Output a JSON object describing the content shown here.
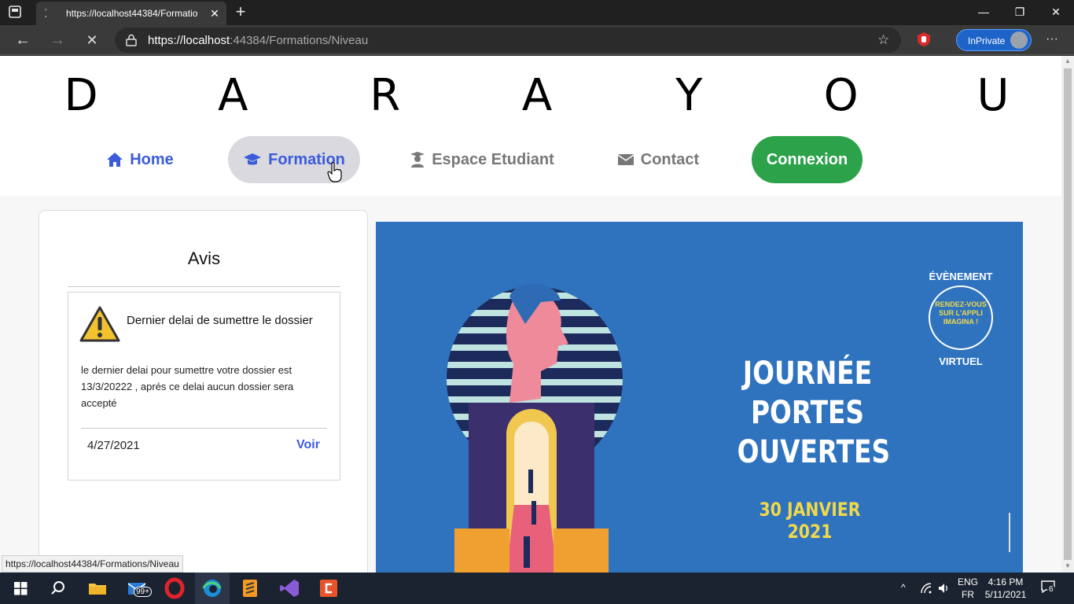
{
  "browser": {
    "tab_title": "https://localhost44384/Formatio",
    "url_main": "https://localhost",
    "url_rest": ":44384/Formations/Niveau",
    "inprivate_label": "InPrivate",
    "status_url": "https://localhost44384/Formations/Niveau"
  },
  "site": {
    "brand_letters": [
      "D",
      "A",
      "R",
      "A",
      "Y",
      "O",
      "U"
    ],
    "nav": {
      "home": "Home",
      "formation": "Formation",
      "etudiant": "Espace Etudiant",
      "contact": "Contact",
      "connexion": "Connexion"
    },
    "avis": {
      "title": "Avis",
      "notice_title": "Dernier delai de sumettre le dossier",
      "notice_body": "le dernier delai pour sumettre votre dossier est 13/3/20222 , aprés ce delai aucun dossier sera accepté",
      "date": "4/27/2021",
      "voir": "Voir"
    },
    "banner": {
      "line1": "JOURNÉE",
      "line2": "PORTES",
      "line3": "OUVERTES",
      "date": "30 JANVIER 2021",
      "badge_top": "ÉVÈNEMENT",
      "badge_mid": "RENDEZ-VOUS SUR L'APPLI IMAGINA !",
      "badge_bottom": "VIRTUEL"
    }
  },
  "taskbar": {
    "mail_badge": "99+",
    "lang_top": "ENG",
    "lang_bottom": "FR",
    "time": "4:16 PM",
    "date": "5/11/2021",
    "notif_count": "6"
  },
  "colors": {
    "accent_blue": "#3b5bdb",
    "connexion_green": "#2ca24a",
    "banner_blue": "#2f73bf",
    "banner_yellow": "#f1d84a"
  }
}
